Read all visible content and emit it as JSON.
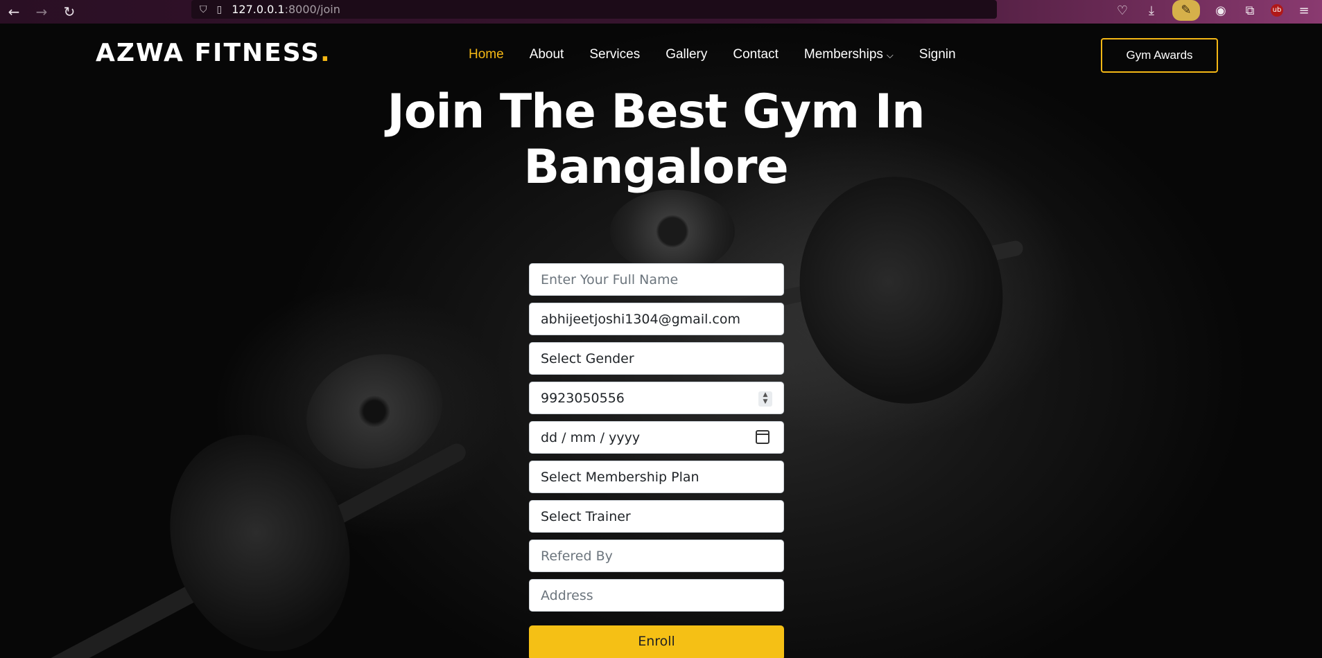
{
  "browser": {
    "back_icon": "←",
    "forward_icon": "→",
    "reload_icon": "↻",
    "url_host": "127.0.0.1",
    "url_rest": ":8000/join",
    "ub_badge": "ub"
  },
  "site": {
    "logo_text": "AZWA FITNESS",
    "logo_dot": ".",
    "nav": [
      {
        "label": "Home",
        "active": true
      },
      {
        "label": "About"
      },
      {
        "label": "Services"
      },
      {
        "label": "Gallery"
      },
      {
        "label": "Contact"
      },
      {
        "label": "Memberships"
      },
      {
        "label": "Signin"
      }
    ],
    "awards_label": "Gym Awards",
    "accent_color": "#f5b815"
  },
  "hero": {
    "headline_line1": "Join The Best Gym In",
    "headline_line2": "Bangalore"
  },
  "form": {
    "full_name_placeholder": "Enter Your Full Name",
    "email_value": "abhijeetjoshi1304@gmail.com",
    "gender_selected": "Select Gender",
    "phone_value": "9923050556",
    "dob_placeholder": "dd / mm / yyyy",
    "membership_selected": "Select Membership Plan",
    "trainer_selected": "Select Trainer",
    "referred_placeholder": "Refered By",
    "address_placeholder": "Address",
    "enroll_label": "Enroll"
  }
}
